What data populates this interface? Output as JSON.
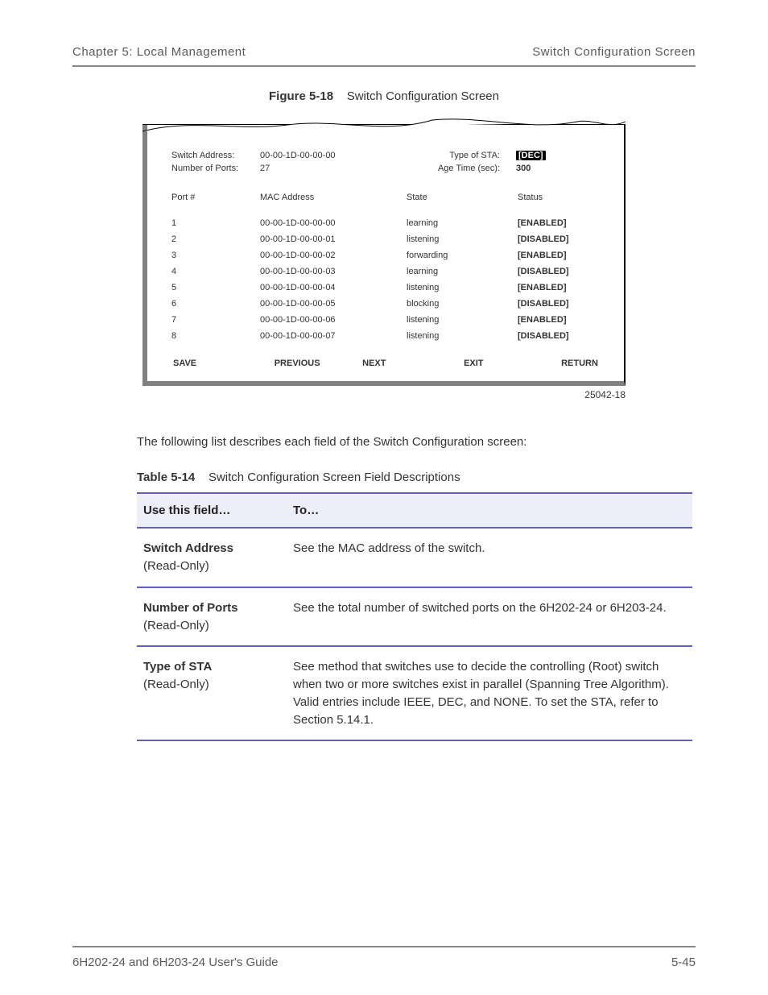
{
  "running_head": {
    "left": "Chapter 5: Local Management",
    "right": "Switch Configuration Screen"
  },
  "figure": {
    "number": "Figure 5-18",
    "title": "Switch Configuration Screen",
    "screen": {
      "top_left": {
        "switch_address_label": "Switch Address:",
        "switch_address_value": "00-00-1D-00-00-00",
        "num_ports_label": "Number of Ports:",
        "num_ports_value": "27"
      },
      "top_right": {
        "type_sta_label": "Type of STA:",
        "type_sta_value": "[DEC]",
        "age_time_label": "Age Time (sec):",
        "age_time_value": "300"
      },
      "headers": {
        "port": "Port #",
        "mac": "MAC Address",
        "state": "State",
        "status": "Status"
      },
      "rows": [
        {
          "port": "1",
          "mac": "00-00-1D-00-00-00",
          "state": "learning",
          "status": "[ENABLED]"
        },
        {
          "port": "2",
          "mac": "00-00-1D-00-00-01",
          "state": "listening",
          "status": "[DISABLED]"
        },
        {
          "port": "3",
          "mac": "00-00-1D-00-00-02",
          "state": "forwarding",
          "status": "[ENABLED]"
        },
        {
          "port": "4",
          "mac": "00-00-1D-00-00-03",
          "state": "learning",
          "status": "[DISABLED]"
        },
        {
          "port": "5",
          "mac": "00-00-1D-00-00-04",
          "state": "listening",
          "status": "[ENABLED]"
        },
        {
          "port": "6",
          "mac": "00-00-1D-00-00-05",
          "state": "blocking",
          "status": "[DISABLED]"
        },
        {
          "port": "7",
          "mac": "00-00-1D-00-00-06",
          "state": "listening",
          "status": "[ENABLED]"
        },
        {
          "port": "8",
          "mac": "00-00-1D-00-00-07",
          "state": "listening",
          "status": "[DISABLED]"
        }
      ],
      "buttons": {
        "save": "SAVE",
        "previous": "PREVIOUS",
        "next": "NEXT",
        "exit": "EXIT",
        "return": "RETURN"
      }
    },
    "image_id": "25042-18"
  },
  "body_paragraph": "The following list describes each field of the Switch Configuration screen:",
  "table": {
    "number": "Table 5-14",
    "title": "Switch Configuration Screen Field Descriptions",
    "columns": {
      "c1": "Use this field…",
      "c2": "To…"
    },
    "rows": [
      {
        "field": "Switch Address",
        "desc": "See the MAC address of the switch."
      },
      {
        "field": "Number of Ports",
        "desc": "See the total number of switched ports on the 6H202‑24 or 6H203‑24."
      },
      {
        "field": "Type of STA",
        "desc": "See method that switches use to decide the controlling (Root) switch when two or more switches exist in parallel (Spanning Tree Algorithm). Valid entries include IEEE, DEC, and NONE. To set the STA, refer to Section 5.14.1."
      }
    ]
  },
  "footer": {
    "left": "6H202-24 and 6H203-24 User's Guide",
    "right": "5-45"
  }
}
